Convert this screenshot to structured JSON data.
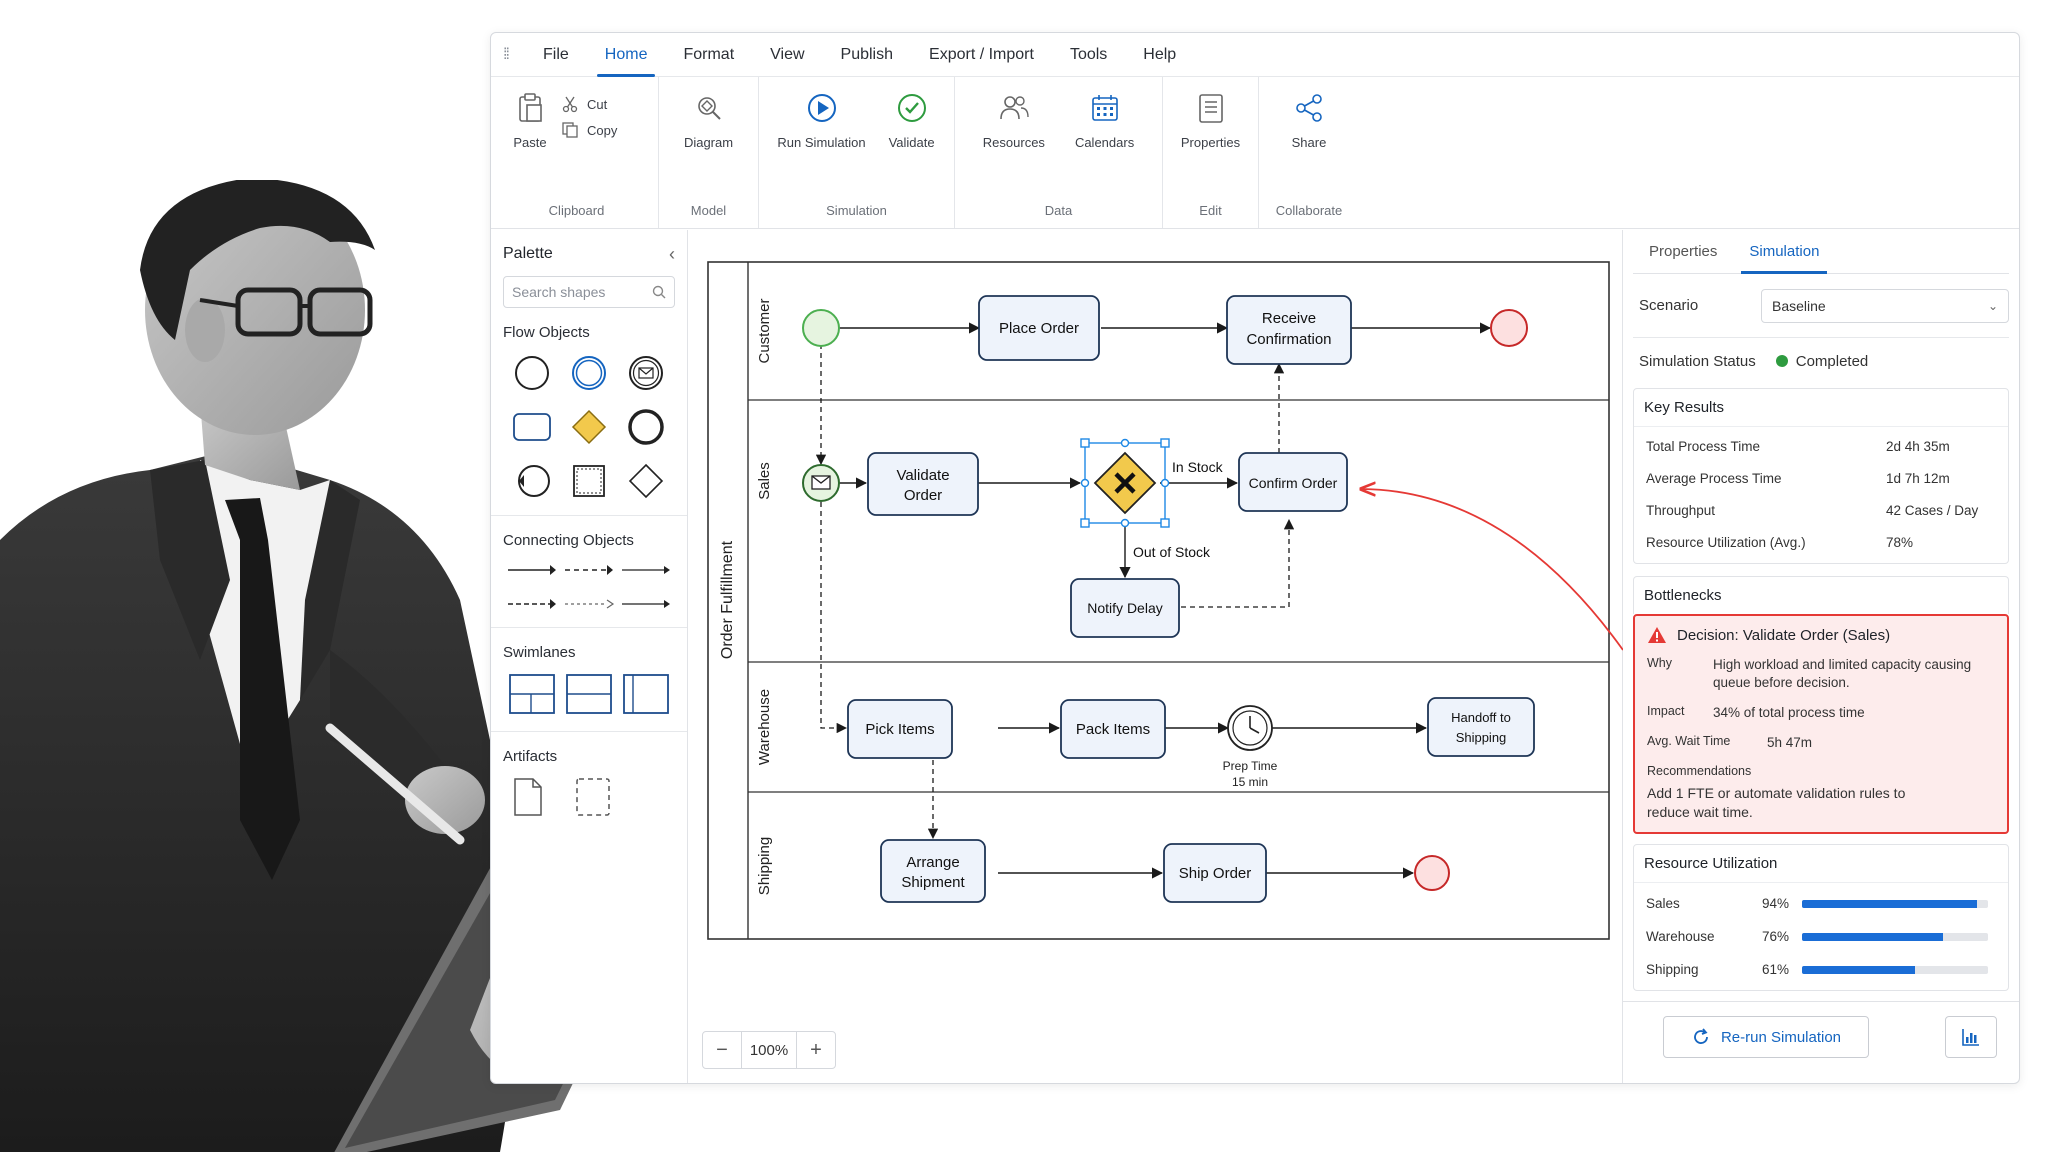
{
  "menu": {
    "items": [
      "File",
      "Home",
      "Format",
      "View",
      "Publish",
      "Export / Import",
      "Tools",
      "Help"
    ],
    "active": "Home"
  },
  "ribbon": {
    "clipboard": {
      "label": "Clipboard",
      "paste": "Paste",
      "cut": "Cut",
      "copy": "Copy"
    },
    "model": {
      "label": "Model",
      "diagram": "Diagram"
    },
    "simulation": {
      "label": "Simulation",
      "run": "Run Simulation",
      "validate": "Validate"
    },
    "data": {
      "label": "Data",
      "resources": "Resources",
      "calendars": "Calendars"
    },
    "edit": {
      "label": "Edit",
      "properties": "Properties"
    },
    "collaborate": {
      "label": "Collaborate",
      "share": "Share"
    }
  },
  "palette": {
    "title": "Palette",
    "search_placeholder": "Search shapes",
    "flow_objects": "Flow Objects",
    "connecting_objects": "Connecting Objects",
    "swimlanes": "Swimlanes",
    "artifacts": "Artifacts"
  },
  "diagram": {
    "pool": "Order Fulfillment",
    "lanes": [
      "Customer",
      "Sales",
      "Warehouse",
      "Shipping"
    ],
    "tasks": {
      "place_order": "Place Order",
      "receive_confirmation": [
        "Receive",
        "Confirmation"
      ],
      "validate_order": [
        "Validate",
        "Order"
      ],
      "confirm_order": "Confirm Order",
      "notify_delay": "Notify Delay",
      "pick_items": "Pick Items",
      "pack_items": "Pack Items",
      "handoff": [
        "Handoff to",
        "Shipping"
      ],
      "arrange_shipment": [
        "Arrange",
        "Shipment"
      ],
      "ship_order": "Ship Order"
    },
    "labels": {
      "in_stock": "In Stock",
      "out_of_stock": "Out of Stock",
      "prep_time": "Prep Time",
      "prep_duration": "15 min"
    }
  },
  "zoom": {
    "level": "100%"
  },
  "panel": {
    "tabs": [
      "Properties",
      "Simulation"
    ],
    "active_tab": "Simulation",
    "scenario_label": "Scenario",
    "scenario_value": "Baseline",
    "status_label": "Simulation Status",
    "status_value": "Completed",
    "status_color": "#2e9b3f",
    "key_results": {
      "title": "Key Results",
      "rows": [
        {
          "k": "Total Process Time",
          "v": "2d 4h 35m"
        },
        {
          "k": "Average Process Time",
          "v": "1d 7h 12m"
        },
        {
          "k": "Throughput",
          "v": "42 Cases / Day"
        },
        {
          "k": "Resource Utilization (Avg.)",
          "v": "78%"
        }
      ]
    },
    "bottlenecks": {
      "title": "Bottlenecks",
      "alert_title": "Decision: Validate Order (Sales)",
      "why_label": "Why",
      "why_value": "High workload and limited capacity causing queue before decision.",
      "impact_label": "Impact",
      "impact_value": "34% of total process time",
      "wait_label": "Avg. Wait Time",
      "wait_value": "5h 47m",
      "rec_label": "Recommendations",
      "rec_value": "Add 1 FTE or automate validation rules to reduce wait time.",
      "alert_color": "#e53935"
    },
    "resource_utilization": {
      "title": "Resource Utilization",
      "rows": [
        {
          "k": "Sales",
          "p": "94%",
          "value": 94
        },
        {
          "k": "Warehouse",
          "p": "76%",
          "value": 76
        },
        {
          "k": "Shipping",
          "p": "61%",
          "value": 61
        }
      ]
    },
    "rerun": "Re-run Simulation"
  },
  "colors": {
    "accent": "#1565c0",
    "start_event": "#4caf50",
    "end_event": "#e53935",
    "gateway": "#f2c94c"
  }
}
